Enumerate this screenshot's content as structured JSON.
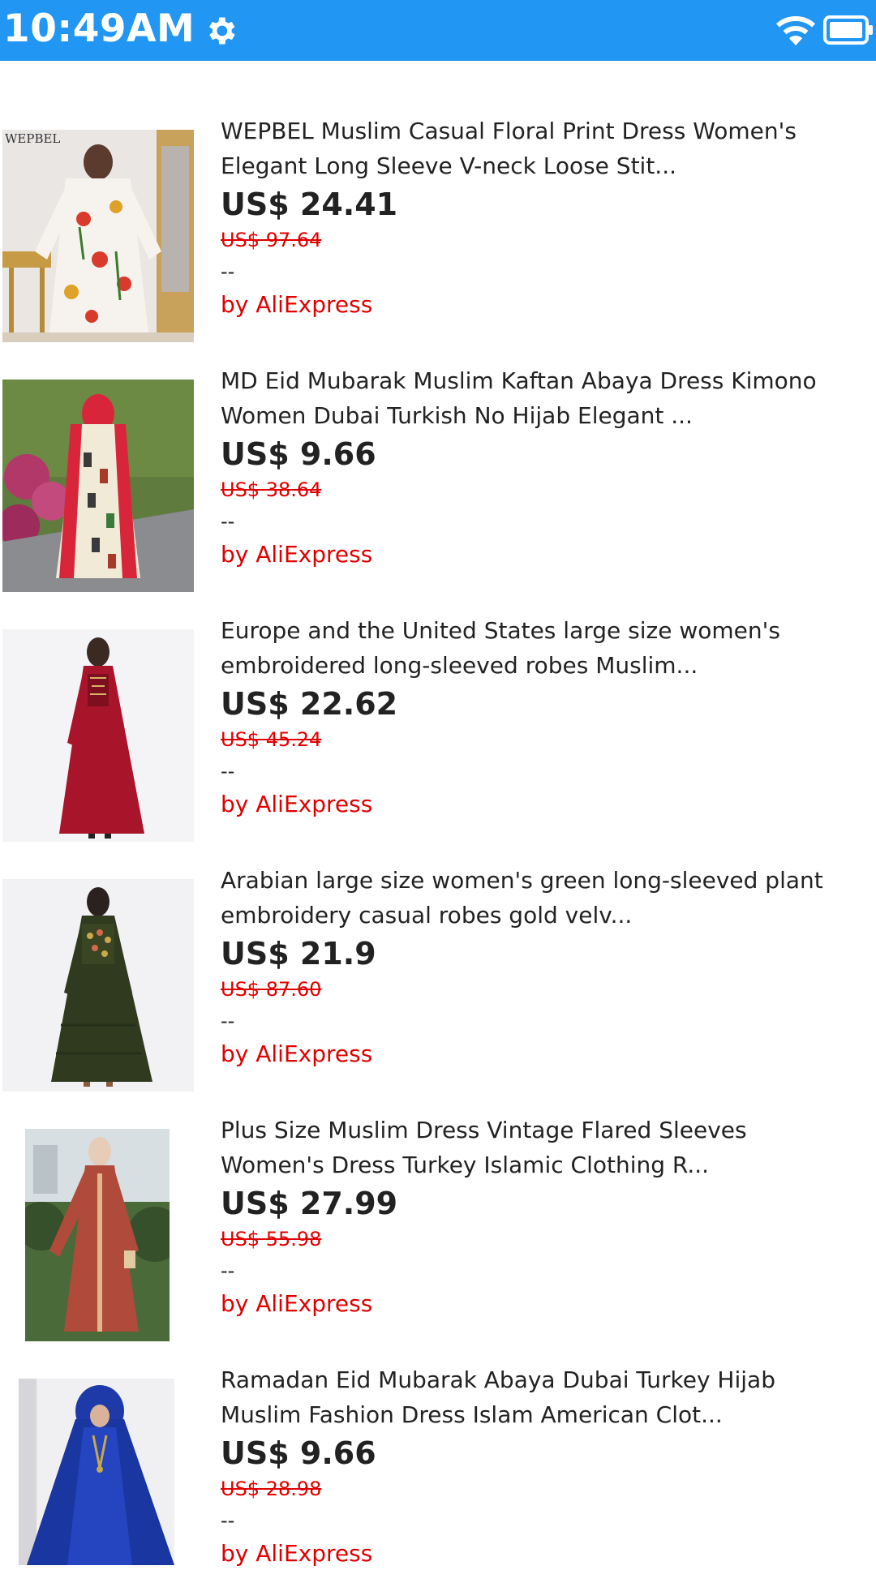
{
  "status_bar": {
    "time": "10:49AM",
    "icons": [
      "gear-icon",
      "wifi-icon",
      "battery-icon"
    ],
    "background": "#2196f3"
  },
  "products": [
    {
      "title_line1": "WEPBEL Muslim Casual Floral Print Dress Women's",
      "title_line2": "Elegant Long Sleeve V-neck Loose Stit...",
      "price": "US$ 24.41",
      "original_price": "US$ 97.64",
      "rating": "--",
      "seller": "by AliExpress",
      "image_text": "WEPBEL"
    },
    {
      "title_line1": "MD Eid Mubarak Muslim Kaftan Abaya Dress Kimono",
      "title_line2": "Women Dubai Turkish No Hijab Elegant ...",
      "price": "US$ 9.66",
      "original_price": "US$ 38.64",
      "rating": "--",
      "seller": "by AliExpress"
    },
    {
      "title_line1": "Europe and the United States large size women's",
      "title_line2": "embroidered long-sleeved robes Muslim...",
      "price": "US$ 22.62",
      "original_price": "US$ 45.24",
      "rating": "--",
      "seller": "by AliExpress"
    },
    {
      "title_line1": "Arabian large size women's green long-sleeved plant",
      "title_line2": "embroidery casual robes gold velv...",
      "price": "US$ 21.9",
      "original_price": "US$ 87.60",
      "rating": "--",
      "seller": "by AliExpress"
    },
    {
      "title_line1": "Plus Size Muslim Dress Vintage Flared Sleeves",
      "title_line2": "Women's Dress Turkey Islamic Clothing R...",
      "price": "US$ 27.99",
      "original_price": "US$ 55.98",
      "rating": "--",
      "seller": "by AliExpress"
    },
    {
      "title_line1": "Ramadan Eid Mubarak Abaya Dubai Turkey Hijab",
      "title_line2": "Muslim Fashion Dress Islam American Clot...",
      "price": "US$ 9.66",
      "original_price": "US$ 28.98",
      "rating": "--",
      "seller": "by AliExpress"
    }
  ],
  "colors": {
    "accent_red": "#e00000",
    "text_dark": "#222222"
  }
}
